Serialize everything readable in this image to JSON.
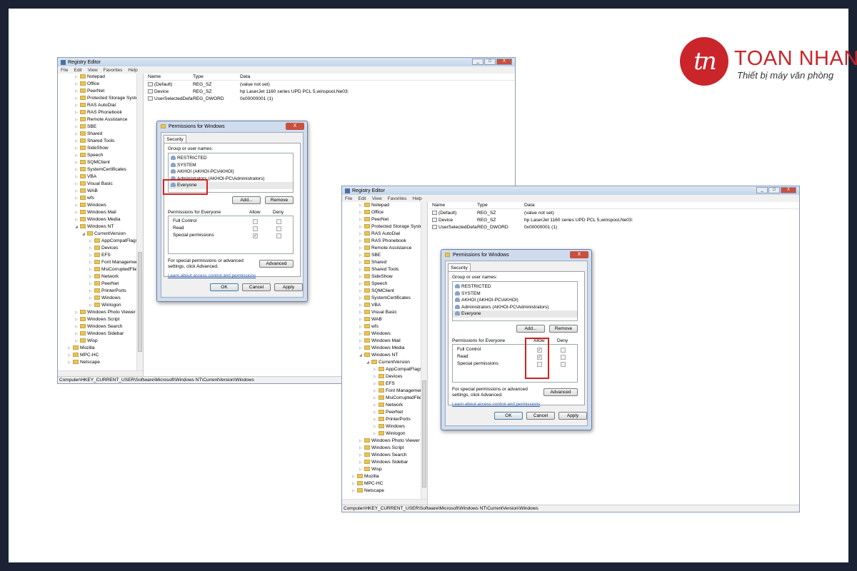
{
  "logo": {
    "mark": "tn",
    "brand": "TOAN NHAN",
    "tagline": "Thiết bị máy văn phòng"
  },
  "registry": {
    "title": "Registry Editor",
    "menu": [
      "File",
      "Edit",
      "View",
      "Favorites",
      "Help"
    ],
    "window_buttons": [
      "_",
      "□",
      "X"
    ],
    "tree": [
      {
        "label": "Notepad",
        "level": 0
      },
      {
        "label": "Office",
        "level": 0
      },
      {
        "label": "PeerNet",
        "level": 0
      },
      {
        "label": "Protected Storage System Provider",
        "level": 0
      },
      {
        "label": "RAS AutoDial",
        "level": 0
      },
      {
        "label": "RAS Phonebook",
        "level": 0
      },
      {
        "label": "Remote Assistance",
        "level": 0
      },
      {
        "label": "SBE",
        "level": 0
      },
      {
        "label": "Shared",
        "level": 0
      },
      {
        "label": "Shared Tools",
        "level": 0
      },
      {
        "label": "SideShow",
        "level": 0
      },
      {
        "label": "Speech",
        "level": 0
      },
      {
        "label": "SQMClient",
        "level": 0
      },
      {
        "label": "SystemCertificates",
        "level": 0
      },
      {
        "label": "VBA",
        "level": 0
      },
      {
        "label": "Visual Basic",
        "level": 0
      },
      {
        "label": "WAB",
        "level": 0
      },
      {
        "label": "wfs",
        "level": 0
      },
      {
        "label": "Windows",
        "level": 0
      },
      {
        "label": "Windows Mail",
        "level": 0
      },
      {
        "label": "Windows Media",
        "level": 0
      },
      {
        "label": "Windows NT",
        "level": 0
      },
      {
        "label": "CurrentVersion",
        "level": 1
      },
      {
        "label": "AppCompatFlags",
        "level": 2
      },
      {
        "label": "Devices",
        "level": 2
      },
      {
        "label": "EFS",
        "level": 2
      },
      {
        "label": "Font Management",
        "level": 2
      },
      {
        "label": "MsiCorruptedFileRecovery",
        "level": 2
      },
      {
        "label": "Network",
        "level": 2
      },
      {
        "label": "PeerNet",
        "level": 2
      },
      {
        "label": "PrinterPorts",
        "level": 2
      },
      {
        "label": "Windows",
        "level": 2
      },
      {
        "label": "Winlogon",
        "level": 2
      },
      {
        "label": "Windows Photo Viewer",
        "level": 0
      },
      {
        "label": "Windows Script",
        "level": 0
      },
      {
        "label": "Windows Search",
        "level": 0
      },
      {
        "label": "Windows Sidebar",
        "level": 0
      },
      {
        "label": "Wisp",
        "level": 0
      },
      {
        "label": "Mozilla",
        "level": -1
      },
      {
        "label": "MPC-HC",
        "level": -1
      },
      {
        "label": "Netscape",
        "level": -1
      }
    ],
    "columns": [
      "Name",
      "Type",
      "Data"
    ],
    "values": [
      {
        "name": "(Default)",
        "type": "REG_SZ",
        "data": "(value not set)"
      },
      {
        "name": "Device",
        "type": "REG_SZ",
        "data": "hp LaserJet 1160 series UPD PCL 5,winspool,Ne03:"
      },
      {
        "name": "UserSelectedDefault",
        "type": "REG_DWORD",
        "data": "0x00000001 (1)"
      }
    ],
    "status": "Computer\\HKEY_CURRENT_USER\\Software\\Microsoft\\Windows NT\\CurrentVersion\\Windows"
  },
  "dialog": {
    "title": "Permissions for Windows",
    "close": "X",
    "tab": "Security",
    "group_label": "Group or user names:",
    "users": [
      "RESTRICTED",
      "SYSTEM",
      "AKHOI (AKHOI-PC\\AKHOI)",
      "Administrators (AKHOI-PC\\Administrators)",
      "Everyone"
    ],
    "add": "Add...",
    "remove": "Remove",
    "perm_label": "Permissions for Everyone",
    "allow": "Allow",
    "deny": "Deny",
    "perms": [
      "Full Control",
      "Read",
      "Special permissions"
    ],
    "special_text": "For special permissions or advanced settings, click Advanced.",
    "advanced": "Advanced",
    "learn_link": "Learn about access control and permissions",
    "ok": "OK",
    "cancel": "Cancel",
    "apply": "Apply",
    "check_glyph": "✓",
    "state1_allow": [
      false,
      false,
      true
    ],
    "state2_allow": [
      true,
      true,
      false
    ]
  }
}
